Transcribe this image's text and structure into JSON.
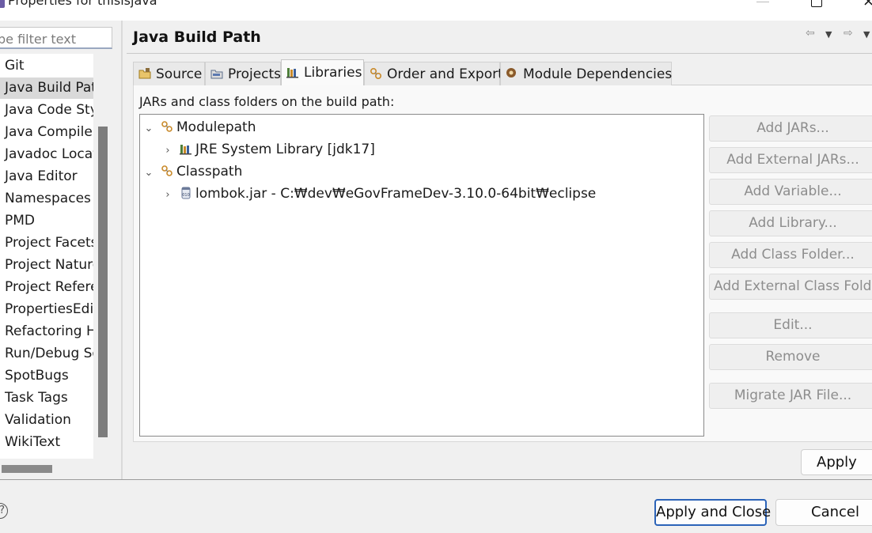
{
  "window": {
    "title": "Properties for thisisjava",
    "controls": {
      "minimize": "minimize-icon",
      "maximize": "maximize-icon",
      "close_glyph": "×"
    }
  },
  "filter": {
    "visible_text": "pe filter text"
  },
  "sidebar": {
    "items": [
      {
        "label": "Git",
        "selected": false
      },
      {
        "label": "Java Build Pat",
        "selected": true
      },
      {
        "label": "Java Code Sty",
        "selected": false
      },
      {
        "label": "Java Compiler",
        "selected": false
      },
      {
        "label": "Javadoc Locat",
        "selected": false
      },
      {
        "label": "Java Editor",
        "selected": false
      },
      {
        "label": "Namespaces",
        "selected": false
      },
      {
        "label": "PMD",
        "selected": false
      },
      {
        "label": "Project Facets",
        "selected": false
      },
      {
        "label": "Project Nature",
        "selected": false
      },
      {
        "label": "Project Refere",
        "selected": false
      },
      {
        "label": "PropertiesEdit",
        "selected": false
      },
      {
        "label": "Refactoring H",
        "selected": false
      },
      {
        "label": "Run/Debug Se",
        "selected": false
      },
      {
        "label": "SpotBugs",
        "selected": false
      },
      {
        "label": "Task Tags",
        "selected": false
      },
      {
        "label": "Validation",
        "selected": false
      },
      {
        "label": "WikiText",
        "selected": false
      }
    ]
  },
  "page": {
    "title": "Java Build Path",
    "nav": {
      "back": "⇦",
      "dropdown": "▼",
      "forward": "⇨",
      "menu": "▼"
    }
  },
  "tabs": [
    {
      "label": "Source",
      "icon": "source-folder-icon",
      "active": false
    },
    {
      "label": "Projects",
      "icon": "projects-icon",
      "active": false
    },
    {
      "label": "Libraries",
      "icon": "libraries-icon",
      "active": true
    },
    {
      "label": "Order and Export",
      "icon": "order-export-icon",
      "active": false
    },
    {
      "label": "Module Dependencies",
      "icon": "module-icon",
      "active": false
    }
  ],
  "libraries": {
    "heading": "JARs and class folders on the build path:",
    "tree": [
      {
        "label": "Modulepath",
        "expanded": true,
        "depth": 0,
        "icon": "modulepath-icon"
      },
      {
        "label": "JRE System Library [jdk17]",
        "expanded": false,
        "depth": 1,
        "icon": "library-icon"
      },
      {
        "label": "Classpath",
        "expanded": true,
        "depth": 0,
        "icon": "classpath-icon"
      },
      {
        "label": "lombok.jar - C:₩dev₩eGovFrameDev-3.10.0-64bit₩eclipse",
        "expanded": false,
        "depth": 1,
        "icon": "jar-icon"
      }
    ],
    "buttons": {
      "add_jars": "Add JARs...",
      "add_external_jars": "Add External JARs...",
      "add_variable": "Add Variable...",
      "add_library": "Add Library...",
      "add_class_folder": "Add Class Folder...",
      "add_external_class_folder": "Add External Class Folder",
      "edit": "Edit...",
      "remove": "Remove",
      "migrate_jar": "Migrate JAR File..."
    }
  },
  "footer": {
    "apply": "Apply",
    "apply_and_close": "Apply and Close",
    "cancel": "Cancel",
    "help_glyph": "?"
  },
  "colors": {
    "accent": "#2b63b8",
    "selection": "#d9d9d9",
    "disabled_text": "#8d8d8d"
  }
}
